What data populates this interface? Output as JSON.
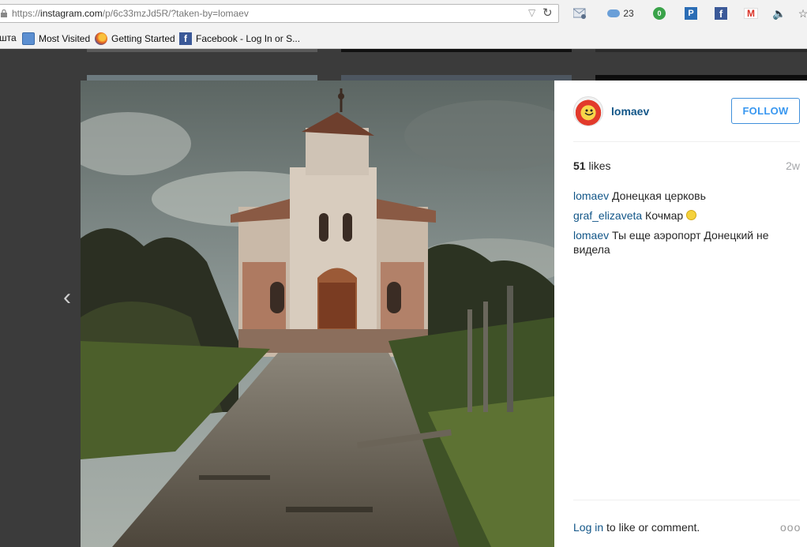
{
  "browser": {
    "url_prefix": "https://",
    "url_host": "instagram.com",
    "url_path": "/p/6c33mzJd5R/?taken-by=lomaev",
    "weather_temp": "23",
    "badge_count": "0",
    "icons": [
      "lock-icon",
      "dropdown-icon",
      "reload-icon",
      "mail-icon",
      "cloud-icon",
      "counter-icon",
      "p-icon",
      "facebook-icon",
      "gmail-icon",
      "speaker-icon",
      "star-icon"
    ]
  },
  "bookmarks": [
    {
      "label": "шта"
    },
    {
      "label": "Most Visited"
    },
    {
      "label": "Getting Started"
    },
    {
      "label": "Facebook - Log In or S..."
    }
  ],
  "post": {
    "username": "lomaev",
    "follow_label": "FOLLOW",
    "likes_count": "51",
    "likes_label": " likes",
    "time_ago": "2w",
    "comments": [
      {
        "user": "lomaev",
        "text": " Донецкая церковь"
      },
      {
        "user": "graf_elizaveta",
        "text": " Кочмар "
      },
      {
        "user": "lomaev",
        "text": " Ты еще аэропорт Донецкий не видела"
      }
    ],
    "login_link": "Log in",
    "login_rest": " to like or comment.",
    "more_label": "ooo"
  },
  "nav": {
    "prev_arrow": "‹"
  },
  "colors": {
    "link": "#125688",
    "follow": "#3897f0",
    "background": "#3b3b3b"
  }
}
